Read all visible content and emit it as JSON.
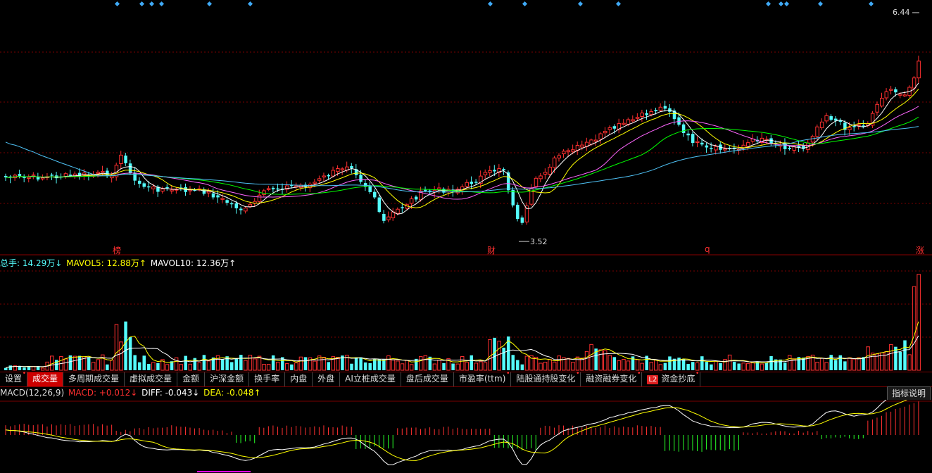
{
  "main": {
    "max_label": "6.44",
    "min_label": "3.52",
    "markers": [
      "榜",
      "财",
      "q",
      "涨"
    ],
    "colors": {
      "up": "#ff3030",
      "down": "#54fcfc",
      "ma5": "#ffffff",
      "ma10": "#ffff00",
      "ma20": "#ff66ff",
      "ma30": "#00ff00",
      "ma60": "#4fc3f7"
    }
  },
  "volume": {
    "label": "总手: 14.29万↓",
    "ma5_label": "MAVOL5: 12.88万↑",
    "ma10_label": "MAVOL10: 12.36万↑"
  },
  "tabs": [
    {
      "label": "设置",
      "dot": "•"
    },
    {
      "label": "成交量",
      "active": true
    },
    {
      "label": "多周期成交量"
    },
    {
      "label": "虚拟成交量"
    },
    {
      "label": "金额"
    },
    {
      "label": "沪深金额"
    },
    {
      "label": "换手率"
    },
    {
      "label": "内盘"
    },
    {
      "label": "外盘"
    },
    {
      "label": "AI立桩成交量"
    },
    {
      "label": "盘后成交量"
    },
    {
      "label": "市盈率(ttm)",
      "dot": "•"
    },
    {
      "label": "陆股通持股变化",
      "dot": "•"
    },
    {
      "label": "融资融券变化",
      "dot": "•"
    },
    {
      "label": "资金抄底",
      "badge": "L2",
      "dot": "•"
    }
  ],
  "macd": {
    "label": "MACD(12,26,9)",
    "macd_label": "MACD: +0.012↓",
    "diff_label": "DIFF: -0.043↓",
    "dea_label": "DEA: -0.048↑",
    "help_button": "指标说明"
  }
}
